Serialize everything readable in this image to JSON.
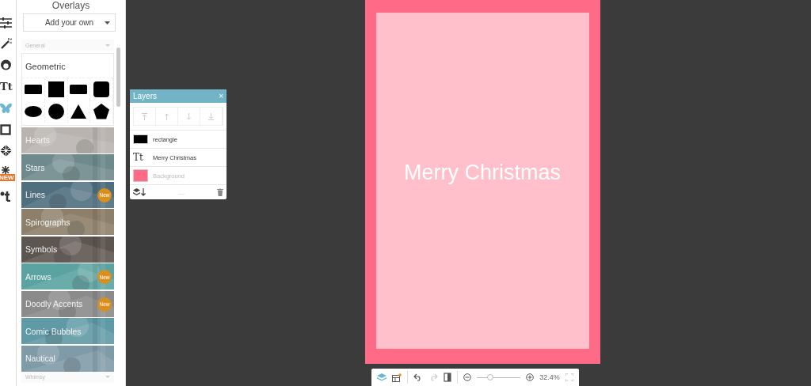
{
  "rail": [
    {
      "kind": "sliders",
      "selected": false
    },
    {
      "kind": "wand",
      "selected": false
    },
    {
      "kind": "face",
      "selected": false
    },
    {
      "kind": "text",
      "label": "Tt",
      "selected": false
    },
    {
      "kind": "butterfly",
      "selected": true
    },
    {
      "kind": "frame",
      "selected": false
    },
    {
      "kind": "knot",
      "selected": false
    },
    {
      "kind": "snow",
      "badge": "NEW",
      "selected": false
    },
    {
      "kind": "stamp",
      "selected": false
    }
  ],
  "panel": {
    "title": "Overlays",
    "add_button": "Add your own",
    "section": "General",
    "featured": {
      "title": "Geometric",
      "shapes": [
        {
          "kind": "rect"
        },
        {
          "kind": "square"
        },
        {
          "kind": "rect"
        },
        {
          "kind": "rsquare"
        },
        {
          "kind": "ellipse"
        },
        {
          "kind": "circle"
        },
        {
          "kind": "triangle"
        },
        {
          "kind": "pentagon"
        }
      ]
    },
    "categories": [
      {
        "label": "Hearts",
        "color": "#b9b4b0"
      },
      {
        "label": "Stars",
        "color": "#6f8a8c"
      },
      {
        "label": "Lines",
        "color": "#4f6f7f",
        "badge": "New"
      },
      {
        "label": "Spirographs",
        "color": "#8d7f6a"
      },
      {
        "label": "Symbols",
        "color": "#5d5550"
      },
      {
        "label": "Arrows",
        "color": "#5aa3a0",
        "badge": "New"
      },
      {
        "label": "Doodly Accents",
        "color": "#8b8b8b",
        "badge": "New"
      },
      {
        "label": "Comic Bubbles",
        "color": "#5f9aa6"
      },
      {
        "label": "Nautical",
        "color": "#7f9ba8"
      }
    ],
    "next_section": "Whimsy"
  },
  "layers": {
    "title": "Layers",
    "close": "×",
    "tools": [
      {
        "kind": "top",
        "disabled": true
      },
      {
        "kind": "up",
        "disabled": true
      },
      {
        "kind": "down",
        "disabled": true
      },
      {
        "kind": "bottom",
        "disabled": true
      }
    ],
    "items": [
      {
        "kind": "swatch",
        "color": "#000000",
        "name": "rectangle",
        "dimmed": false
      },
      {
        "kind": "text",
        "icon": "Tt",
        "name": "Merry Christmas",
        "dimmed": false
      },
      {
        "kind": "swatch",
        "color": "#ff6b86",
        "name": "Background",
        "dimmed": true
      }
    ],
    "more": "...."
  },
  "canvas": {
    "text": "Merry Christmas"
  },
  "zoombar": {
    "layers_selected": true,
    "redo_disabled": true,
    "level": 0.3,
    "zoom": "32.4%"
  }
}
